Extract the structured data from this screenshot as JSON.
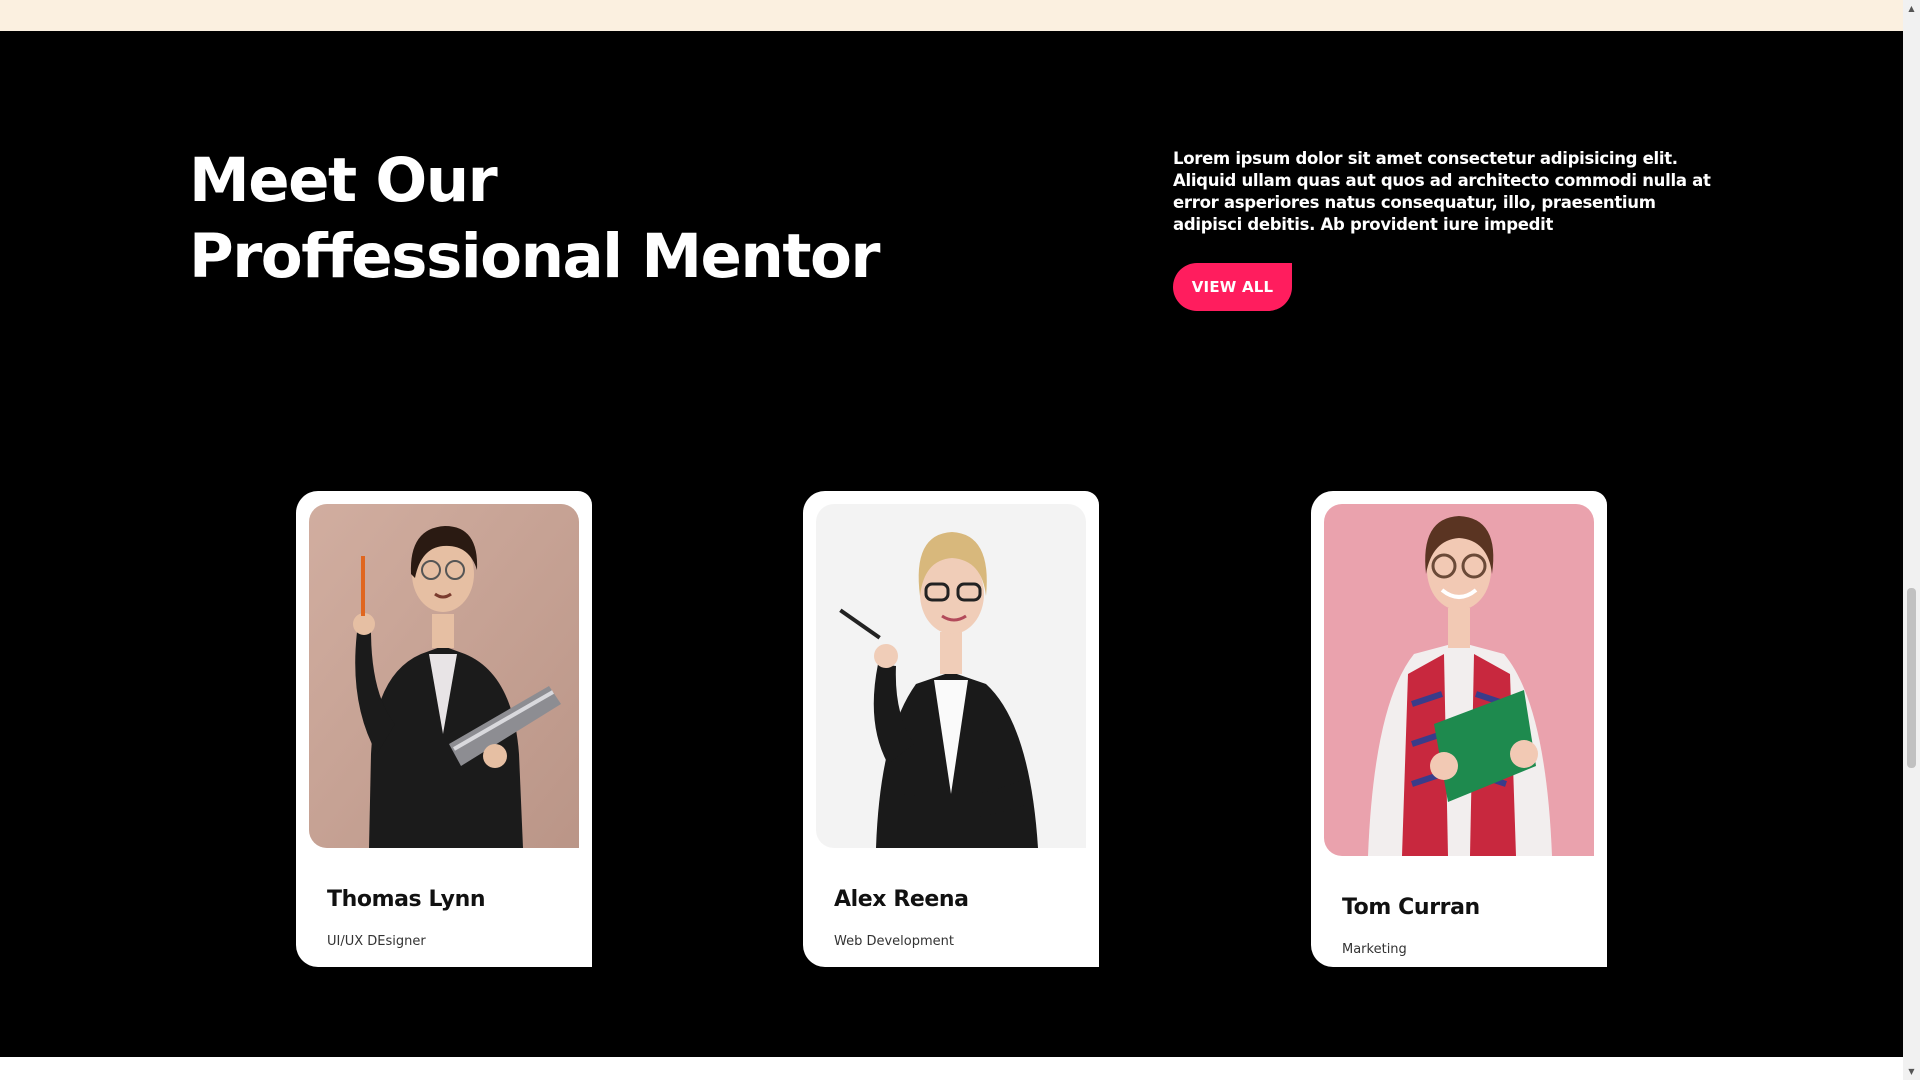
{
  "section": {
    "heading_line1": "Meet Our",
    "heading_line2": "Proffessional Mentor",
    "intro": "Lorem ipsum dolor sit amet consectetur adipisicing elit. Aliquid ullam quas aut quos ad architecto commodi nulla at error asperiores natus consequatur, illo, praesentium adipisci debitis. Ab provident iure impedit",
    "view_all_label": "VIEW ALL"
  },
  "mentors": [
    {
      "name": "Thomas Lynn",
      "role": "UI/UX DEsigner",
      "photo_bg": "#c9a496"
    },
    {
      "name": "Alex Reena",
      "role": "Web Development",
      "photo_bg": "#f3f3f3"
    },
    {
      "name": "Tom Curran",
      "role": "Marketing",
      "photo_bg": "#eaa2ad"
    }
  ],
  "colors": {
    "accent": "#ff1d5e",
    "section_bg": "#000000",
    "top_strip": "#fbf0e0",
    "card_bg": "#ffffff"
  },
  "scrollbar": {
    "up_icon": "triangle-up-icon",
    "down_icon": "triangle-down-icon"
  }
}
